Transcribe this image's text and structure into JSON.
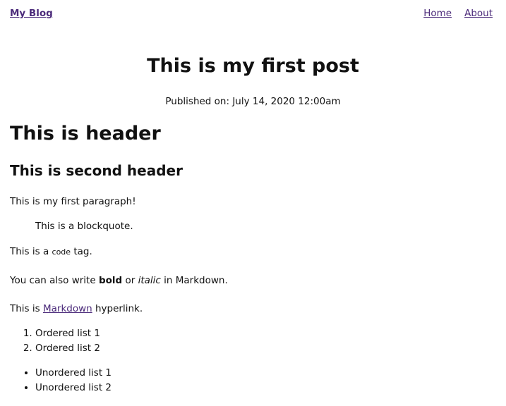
{
  "header": {
    "brand": "My Blog",
    "nav": [
      {
        "label": "Home"
      },
      {
        "label": "About"
      }
    ]
  },
  "post": {
    "title": "This is my first post",
    "published": "Published on: July 14, 2020 12:00am",
    "h1": "This is header",
    "h2": "This is second header",
    "paragraph1": "This is my first paragraph!",
    "blockquote": "This is a blockquote.",
    "code_line": {
      "before": "This is a ",
      "code": "code",
      "after": " tag."
    },
    "format_line": {
      "before": "You can also write ",
      "bold": "bold",
      "middle": " or ",
      "italic": "italic",
      "after": " in Markdown."
    },
    "link_line": {
      "before": "This is ",
      "link": "Markdown",
      "after": " hyperlink."
    },
    "ordered_list": [
      "Ordered list 1",
      "Ordered list 2"
    ],
    "unordered_list": [
      "Unordered list 1",
      "Unordered list 2"
    ]
  }
}
